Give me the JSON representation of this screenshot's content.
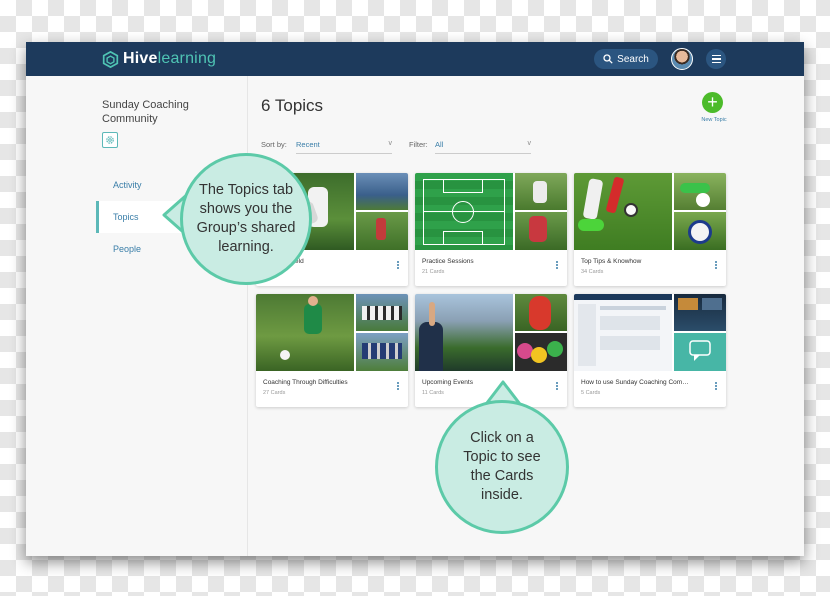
{
  "app": {
    "logo_primary": "Hive",
    "logo_secondary": "learning"
  },
  "header": {
    "search_label": "Search"
  },
  "sidebar": {
    "community_name": "Sunday Coaching Community",
    "nav": [
      {
        "label": "Activity"
      },
      {
        "label": "Topics"
      },
      {
        "label": "People"
      }
    ]
  },
  "main": {
    "title": "6 Topics",
    "new_topic_label": "New Topic",
    "sort_label": "Sort by:",
    "sort_value": "Recent",
    "filter_label": "Filter:",
    "filter_value": "All"
  },
  "cards": [
    {
      "title": "…m The Field",
      "count": ""
    },
    {
      "title": "Practice Sessions",
      "count": "21 Cards"
    },
    {
      "title": "Top Tips & Knowhow",
      "count": "34 Cards"
    },
    {
      "title": "Coaching Through Difficulties",
      "count": "27 Cards"
    },
    {
      "title": "Upcoming Events",
      "count": "11 Cards"
    },
    {
      "title": "How to use Sunday Coaching Com…",
      "count": "5 Cards"
    }
  ],
  "callouts": {
    "topics_tab": "The Topics tab shows you the Group’s shared learning.",
    "click_topic": "Click on a Topic to see the Cards inside."
  },
  "colors": {
    "header": "#1d3a5c",
    "accent_teal": "#5cb8b8",
    "link_blue": "#3a7ea8",
    "new_topic_green": "#4cbb2a",
    "callout_fill": "#c9ece3",
    "callout_border": "#5ccaa8"
  },
  "icons": [
    "hive-logo-icon",
    "search-icon",
    "menu-icon",
    "settings-icon",
    "plus-icon",
    "more-vertical-icon"
  ]
}
